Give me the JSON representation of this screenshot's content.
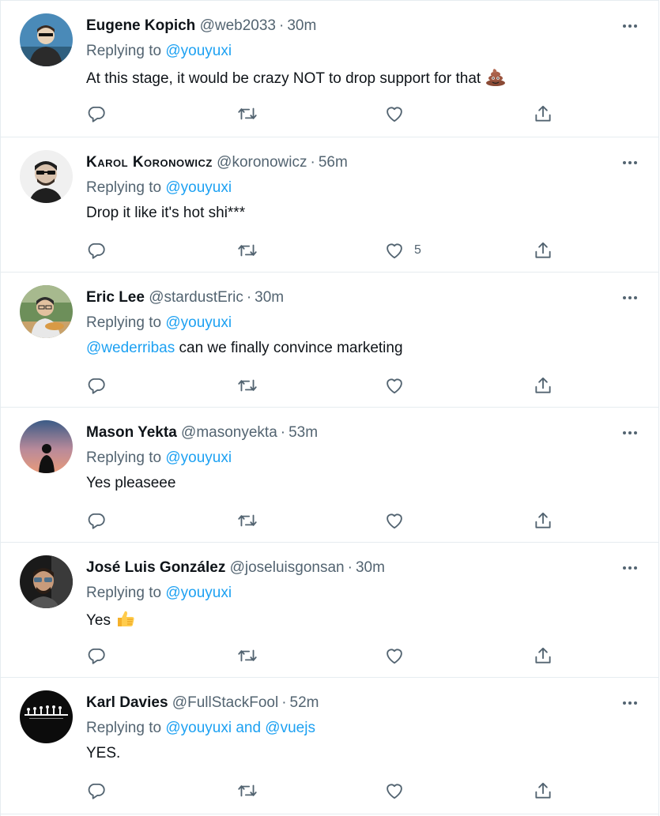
{
  "tweets": [
    {
      "name": "Eugene Kopich",
      "handle": "@web2033",
      "time": "30m",
      "reply_prefix": "Replying to ",
      "reply_to": "@youyuxi",
      "text": "At this stage, it would be crazy NOT to drop support for that",
      "emoji": "pile-of-poo",
      "likes": "",
      "avatar_colors": [
        "#4a8ab8",
        "#e8d2b8",
        "#2b2b2b"
      ]
    },
    {
      "name": "Karol Koronowicz",
      "handle": "@koronowicz",
      "time": "56m",
      "reply_prefix": "Replying to ",
      "reply_to": "@youyuxi",
      "text": "Drop it like it's hot shi***",
      "likes": "5",
      "avatar_colors": [
        "#f0f0f0",
        "#d9c2ad",
        "#1f1f1f"
      ]
    },
    {
      "name": "Eric Lee",
      "handle": "@stardustEric",
      "time": "30m",
      "reply_prefix": "Replying to ",
      "reply_to": "@youyuxi",
      "mention": "@wederribas",
      "text": " can we finally convince marketing",
      "likes": "",
      "avatar_colors": [
        "#6d8f5a",
        "#e2c19f",
        "#2c2c2c"
      ]
    },
    {
      "name": "Mason Yekta",
      "handle": "@masonyekta",
      "time": "53m",
      "reply_prefix": "Replying to ",
      "reply_to": "@youyuxi",
      "text": "Yes pleaseee",
      "likes": "",
      "avatar_colors": [
        "#3b5b86",
        "#e89a7a",
        "#101010"
      ]
    },
    {
      "name": "José Luis González",
      "handle": "@joseluisgonsan",
      "time": "30m",
      "reply_prefix": "Replying to ",
      "reply_to": "@youyuxi",
      "text": "Yes",
      "emoji": "thumbs-up",
      "likes": "",
      "avatar_colors": [
        "#1a1a1a",
        "#c89b7b",
        "#3a3a3a"
      ]
    },
    {
      "name": "Karl Davies",
      "handle": "@FullStackFool",
      "time": "52m",
      "reply_prefix": "Replying to ",
      "reply_to": "@youyuxi and @vuejs",
      "text": "YES.",
      "likes": "",
      "avatar_colors": [
        "#0c0c0c",
        "#f5f5f5",
        "#0c0c0c"
      ]
    }
  ],
  "colors": {
    "link": "#1da1f2",
    "secondary_text": "#536471",
    "primary_text": "#0f1419",
    "divider": "#e6ecf0"
  }
}
